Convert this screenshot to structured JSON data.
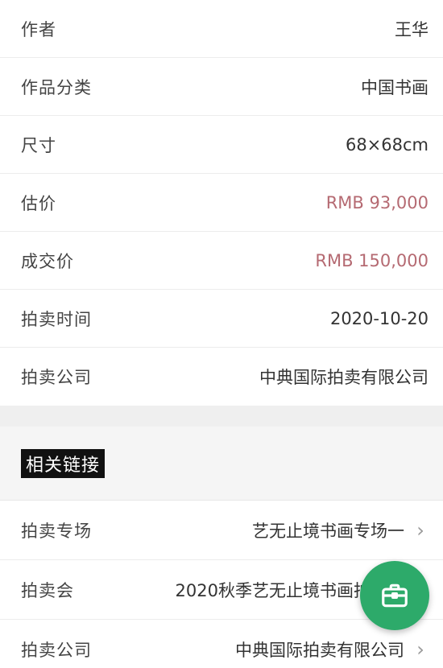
{
  "details": [
    {
      "label": "作者",
      "value": "王华",
      "kind": "text"
    },
    {
      "label": "作品分类",
      "value": "中国书画",
      "kind": "text"
    },
    {
      "label": "尺寸",
      "value": "68×68cm",
      "kind": "text"
    },
    {
      "label": "估价",
      "value": "RMB 93,000",
      "kind": "price"
    },
    {
      "label": "成交价",
      "value": "RMB 150,000",
      "kind": "price"
    },
    {
      "label": "拍卖时间",
      "value": "2020-10-20",
      "kind": "text"
    },
    {
      "label": "拍卖公司",
      "value": "中典国际拍卖有限公司",
      "kind": "text"
    }
  ],
  "related": {
    "title": "相关链接",
    "links": [
      {
        "label": "拍卖专场",
        "value": "艺无止境书画专场一"
      },
      {
        "label": "拍卖会",
        "value": "2020秋季艺无止境书画拍卖会"
      },
      {
        "label": "拍卖公司",
        "value": "中典国际拍卖有限公司"
      }
    ]
  },
  "fab": {
    "icon": "briefcase-icon"
  },
  "colors": {
    "price": "#b56a72",
    "fab": "#2daa6a",
    "title_bg": "#111111"
  }
}
